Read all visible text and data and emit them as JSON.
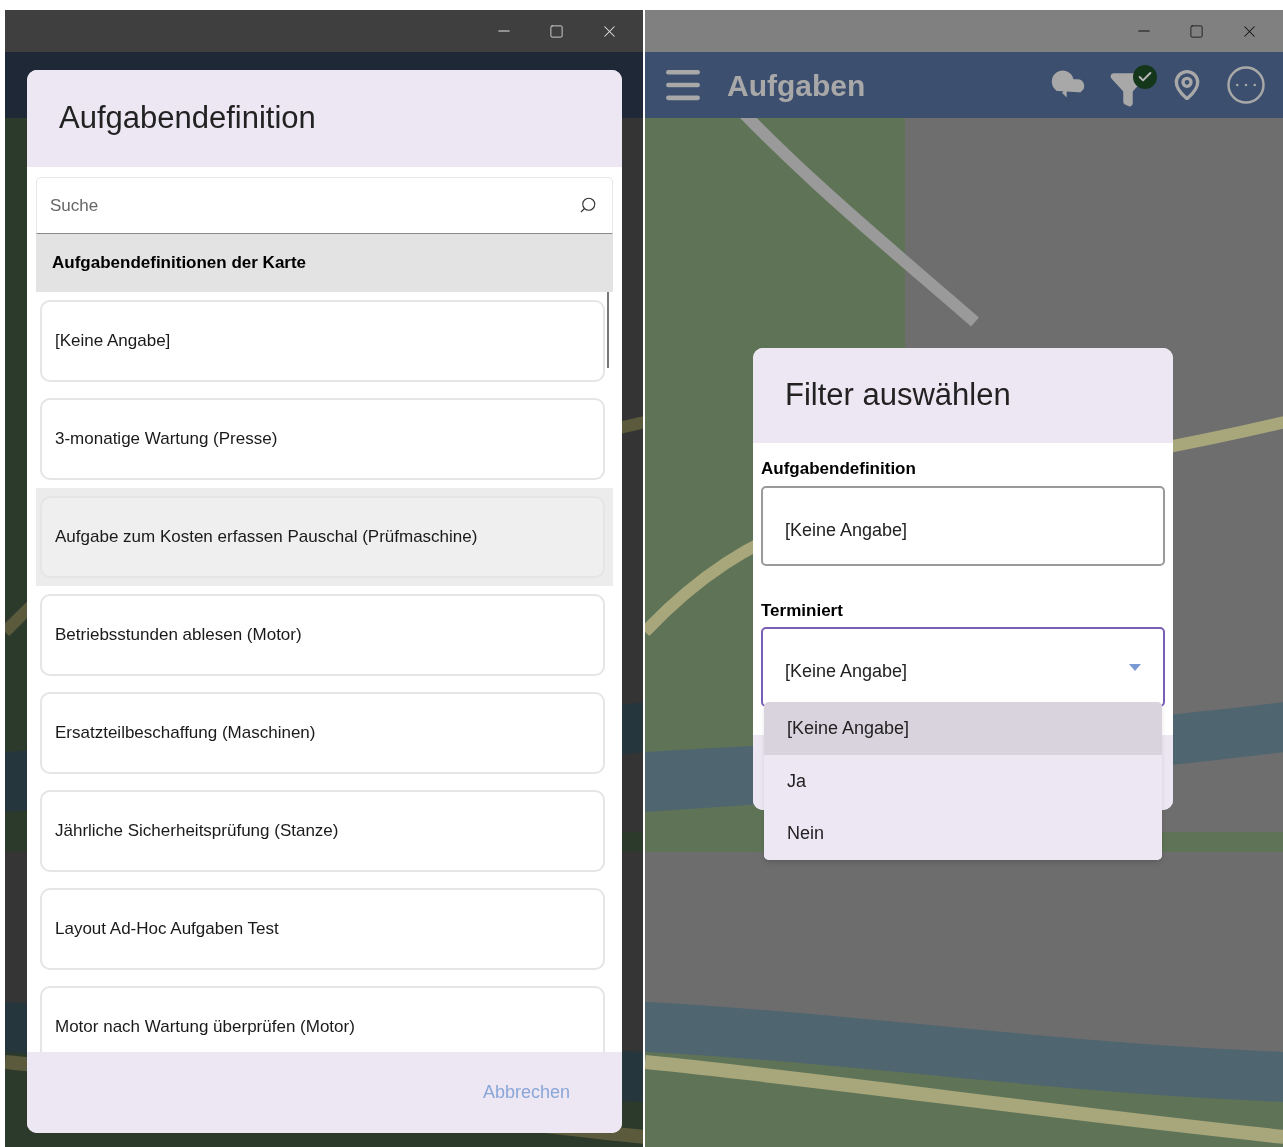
{
  "left_window": {
    "dialog": {
      "title": "Aufgabendefinition",
      "search": {
        "placeholder": "Suche"
      },
      "group_header": "Aufgabendefinitionen der Karte",
      "items": [
        {
          "label": "[Keine Angabe]",
          "selected": false
        },
        {
          "label": "3-monatige Wartung (Presse)",
          "selected": false
        },
        {
          "label": "Aufgabe zum Kosten erfassen Pauschal (Prüfmaschine)",
          "selected": true
        },
        {
          "label": "Betriebsstunden ablesen (Motor)",
          "selected": false
        },
        {
          "label": "Ersatzteilbeschaffung (Maschinen)",
          "selected": false
        },
        {
          "label": "Jährliche Sicherheitsprüfung (Stanze)",
          "selected": false
        },
        {
          "label": "Layout Ad-Hoc Aufgaben Test",
          "selected": false
        },
        {
          "label": "Motor nach Wartung überprüfen (Motor)",
          "selected": false
        }
      ],
      "cancel_button": "Abbrechen"
    }
  },
  "right_window": {
    "app_bar": {
      "title": "Aufgaben",
      "filter_active": true
    },
    "dialog": {
      "title": "Filter auswählen",
      "fields": [
        {
          "label": "Aufgabendefinition",
          "value": "[Keine Angabe]",
          "kind": "text",
          "focused": false
        },
        {
          "label": "Terminiert",
          "value": "[Keine Angabe]",
          "kind": "dropdown",
          "focused": true
        }
      ],
      "dropdown_options": [
        {
          "label": "[Keine Angabe]",
          "selected": true
        },
        {
          "label": "Ja",
          "selected": false
        },
        {
          "label": "Nein",
          "selected": false
        }
      ]
    }
  }
}
